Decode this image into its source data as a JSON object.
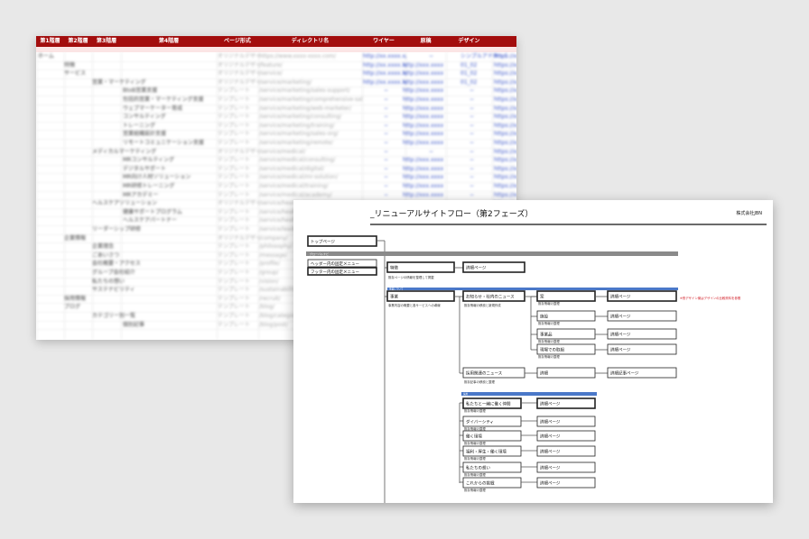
{
  "spreadsheet": {
    "headers": [
      "第1階層",
      "第2階層",
      "第3階層",
      "第4階層",
      "ページ形式",
      "ディレクトリ名",
      "ワイヤー",
      "原稿",
      "デザイン"
    ],
    "rows": [
      {
        "c1": "ホーム",
        "c4": "",
        "fmt": "オリジナルデザイン",
        "dir": "https://www.xxxx-xxxx.com/",
        "w": "http://xx.xxxx.x/",
        "g": "−",
        "d": "シンプルアドホック",
        "e": "https://xx"
      },
      {
        "c2": "特徴",
        "fmt": "オリジナルデザイン",
        "dir": "/feature/",
        "w": "http://xx.xxxx.x/",
        "g": "http://xxx.xxxx.x/",
        "d": "01_02",
        "e": "https://xx"
      },
      {
        "c2": "サービス",
        "fmt": "オリジナルデザイン",
        "dir": "/service/",
        "w": "http://xx.xxxx.x/",
        "g": "http://xxx.xxxx.x/",
        "d": "01_02",
        "e": "https://xx"
      },
      {
        "c3": "営業・マーケティング",
        "fmt": "オリジナルデザイン",
        "dir": "/service/marketing/",
        "w": "http://xx.xxxx.x/",
        "g": "http://xxx.xxxx.x/",
        "d": "01_02",
        "e": "https://xx"
      },
      {
        "c4": "BtoB営業支援",
        "fmt": "テンプレート",
        "dir": "/service/marketing/sales-support/",
        "w": "−",
        "g": "http://xxx.xxxx.x/",
        "d": "−",
        "e": "https://xx"
      },
      {
        "c4": "包括的営業・マーケティング支援",
        "fmt": "テンプレート",
        "dir": "/service/marketing/comprehensive-sales-support/",
        "w": "−",
        "g": "http://xxx.xxxx.x/",
        "d": "−",
        "e": "https://xx"
      },
      {
        "c4": "ウェブマーケーター育成",
        "fmt": "テンプレート",
        "dir": "/service/marketing/web-marketer/",
        "w": "−",
        "g": "http://xxx.xxxx.x/",
        "d": "−",
        "e": "https://xx"
      },
      {
        "c4": "コンサルティング",
        "fmt": "テンプレート",
        "dir": "/service/marketing/consulting/",
        "w": "−",
        "g": "http://xxx.xxxx.x/",
        "d": "−",
        "e": "https://xx"
      },
      {
        "c4": "トレーニング",
        "fmt": "テンプレート",
        "dir": "/service/marketing/training/",
        "w": "−",
        "g": "http://xxx.xxxx.x/",
        "d": "−",
        "e": "https://xx"
      },
      {
        "c4": "営業組織設計支援",
        "fmt": "テンプレート",
        "dir": "/service/marketing/sales-org/",
        "w": "−",
        "g": "http://xxx.xxxx.x/",
        "d": "−",
        "e": "https://xx"
      },
      {
        "c4": "リモートコミュニケーション支援",
        "fmt": "テンプレート",
        "dir": "/service/marketing/remote/",
        "w": "−",
        "g": "http://xxx.xxxx.x/",
        "d": "−",
        "e": "https://xx"
      },
      {
        "c3": "メディカルマーケティング",
        "fmt": "オリジナルデザイン",
        "dir": "/service/medical/",
        "w": "−",
        "g": "−",
        "d": "−",
        "e": "https://xx"
      },
      {
        "c4": "MRコンサルティング",
        "fmt": "テンプレート",
        "dir": "/service/medical/consulting/",
        "w": "−",
        "g": "http://xxx.xxxx.x/",
        "d": "−",
        "e": "https://xx"
      },
      {
        "c4": "デジタルサポート",
        "fmt": "テンプレート",
        "dir": "/service/medical/digital/",
        "w": "−",
        "g": "http://xxx.xxxx.x/",
        "d": "−",
        "e": "https://xx"
      },
      {
        "c4": "MR向け人材ソリューション",
        "fmt": "テンプレート",
        "dir": "/service/medical/mr-solution/",
        "w": "−",
        "g": "http://xxx.xxxx.x/",
        "d": "−",
        "e": "https://xx"
      },
      {
        "c4": "MR研修トレーニング",
        "fmt": "テンプレート",
        "dir": "/service/medical/training/",
        "w": "−",
        "g": "http://xxx.xxxx.x/",
        "d": "−",
        "e": "https://xx"
      },
      {
        "c4": "MRアカデミー",
        "fmt": "テンプレート",
        "dir": "/service/medical/academy/",
        "w": "−",
        "g": "http://xxx.xxxx.x/",
        "d": "−",
        "e": "https://xx"
      },
      {
        "c3": "ヘルスケアソリューション",
        "fmt": "オリジナルデザイン",
        "dir": "/service/healthcare/",
        "w": "−",
        "g": "−",
        "d": "−",
        "e": "https://xx"
      },
      {
        "c4": "健康サポートプログラム",
        "fmt": "テンプレート",
        "dir": "/service/healthcare/program/",
        "w": "−",
        "g": "http://xxx.xxxx.x/",
        "d": "−",
        "e": "https://xx"
      },
      {
        "c4": "ヘルスケアパートナー",
        "fmt": "テンプレート",
        "dir": "/service/healthcare/partner/",
        "w": "−",
        "g": "http://xxx.xxxx.x/",
        "d": "−",
        "e": "https://xx"
      },
      {
        "c3": "リーダーシップ研修",
        "fmt": "テンプレート",
        "dir": "/service/leadership/",
        "w": "−",
        "g": "−",
        "d": "−",
        "e": "https://xx"
      },
      {
        "c2": "企業情報",
        "fmt": "オリジナルデザイン",
        "dir": "/company/",
        "w": "−",
        "g": "−",
        "d": "−",
        "e": "https://xx"
      },
      {
        "c3": "企業理念",
        "fmt": "テンプレート",
        "dir": "/philosophy/",
        "w": "−",
        "g": "−",
        "d": "−",
        "e": "https://xx"
      },
      {
        "c3": "ごあいさつ",
        "fmt": "テンプレート",
        "dir": "/message/",
        "w": "−",
        "g": "−",
        "d": "−",
        "e": "https://xx"
      },
      {
        "c3": "会社概要・アクセス",
        "fmt": "テンプレート",
        "dir": "/profile/",
        "w": "−",
        "g": "−",
        "d": "−",
        "e": "https://xx"
      },
      {
        "c3": "グループ会社紹介",
        "fmt": "テンプレート",
        "dir": "/group/",
        "w": "−",
        "g": "−",
        "d": "−",
        "e": "https://xx"
      },
      {
        "c3": "私たちの想い",
        "fmt": "テンプレート",
        "dir": "/vision/",
        "w": "−",
        "g": "−",
        "d": "−",
        "e": "https://xx"
      },
      {
        "c3": "サステナビリティ",
        "fmt": "テンプレート",
        "dir": "/sustainability/",
        "w": "−",
        "g": "−",
        "d": "−",
        "e": "https://xx"
      },
      {
        "c2": "採用情報",
        "fmt": "テンプレート",
        "dir": "/recruit/",
        "w": "−",
        "g": "−",
        "d": "−",
        "e": "https://xx"
      },
      {
        "c2": "ブログ",
        "fmt": "テンプレート",
        "dir": "/blog/",
        "w": "−",
        "g": "−",
        "d": "−",
        "e": "https://xx"
      },
      {
        "c3": "カテゴリー別一覧",
        "fmt": "テンプレート",
        "dir": "/blog/category/",
        "w": "−",
        "g": "−",
        "d": "−",
        "e": "https://xx"
      },
      {
        "c4": "個別記事",
        "fmt": "テンプレート",
        "dir": "/blog/post/",
        "w": "−",
        "g": "−",
        "d": "−",
        "e": "https://xx"
      }
    ]
  },
  "flow": {
    "title": "_リニューアルサイトフロー（第2フェーズ）",
    "company": "株式会社JBN",
    "top_box": "トップページ",
    "left_boxes": [
      "ヘッダー内の固定メニュー",
      "フッター内の固定メニュー"
    ],
    "section_labels": [
      "グローバルナビ",
      "事業について",
      "採用"
    ],
    "annotation": "※別デザイン案はデザインの比較資料を参照",
    "nodes": {
      "feature": {
        "label": "特徴",
        "note": "既存ページの情報を整理して掲載"
      },
      "feature_child": {
        "label": "詳細ページ"
      },
      "business": {
        "label": "事業",
        "note": "事業内容の概要と各サービスへの導線"
      },
      "news": {
        "label": "お知らせ・社内のニュース",
        "note": "既存情報の移設と新規作成"
      },
      "media": {
        "label": "採用関連のニュース",
        "note": "既存記事の移設と整理"
      },
      "recruit_root": {
        "label": "私たちと一緒に働く仲間"
      },
      "interview": {
        "label": "ダイバーシティ"
      },
      "work": {
        "label": "働く環境"
      },
      "welfare": {
        "label": "福利・厚生・働く環境"
      },
      "career": {
        "label": "私たちの想い"
      },
      "entry": {
        "label": "これからの挑戦"
      },
      "news_children": [
        "案",
        "施設",
        "事業品",
        "現場での取組"
      ],
      "media_child": "詳細",
      "detail": "詳細ページ",
      "detail_media": "詳細記事ページ",
      "detail_note": "既存情報の整理"
    }
  }
}
